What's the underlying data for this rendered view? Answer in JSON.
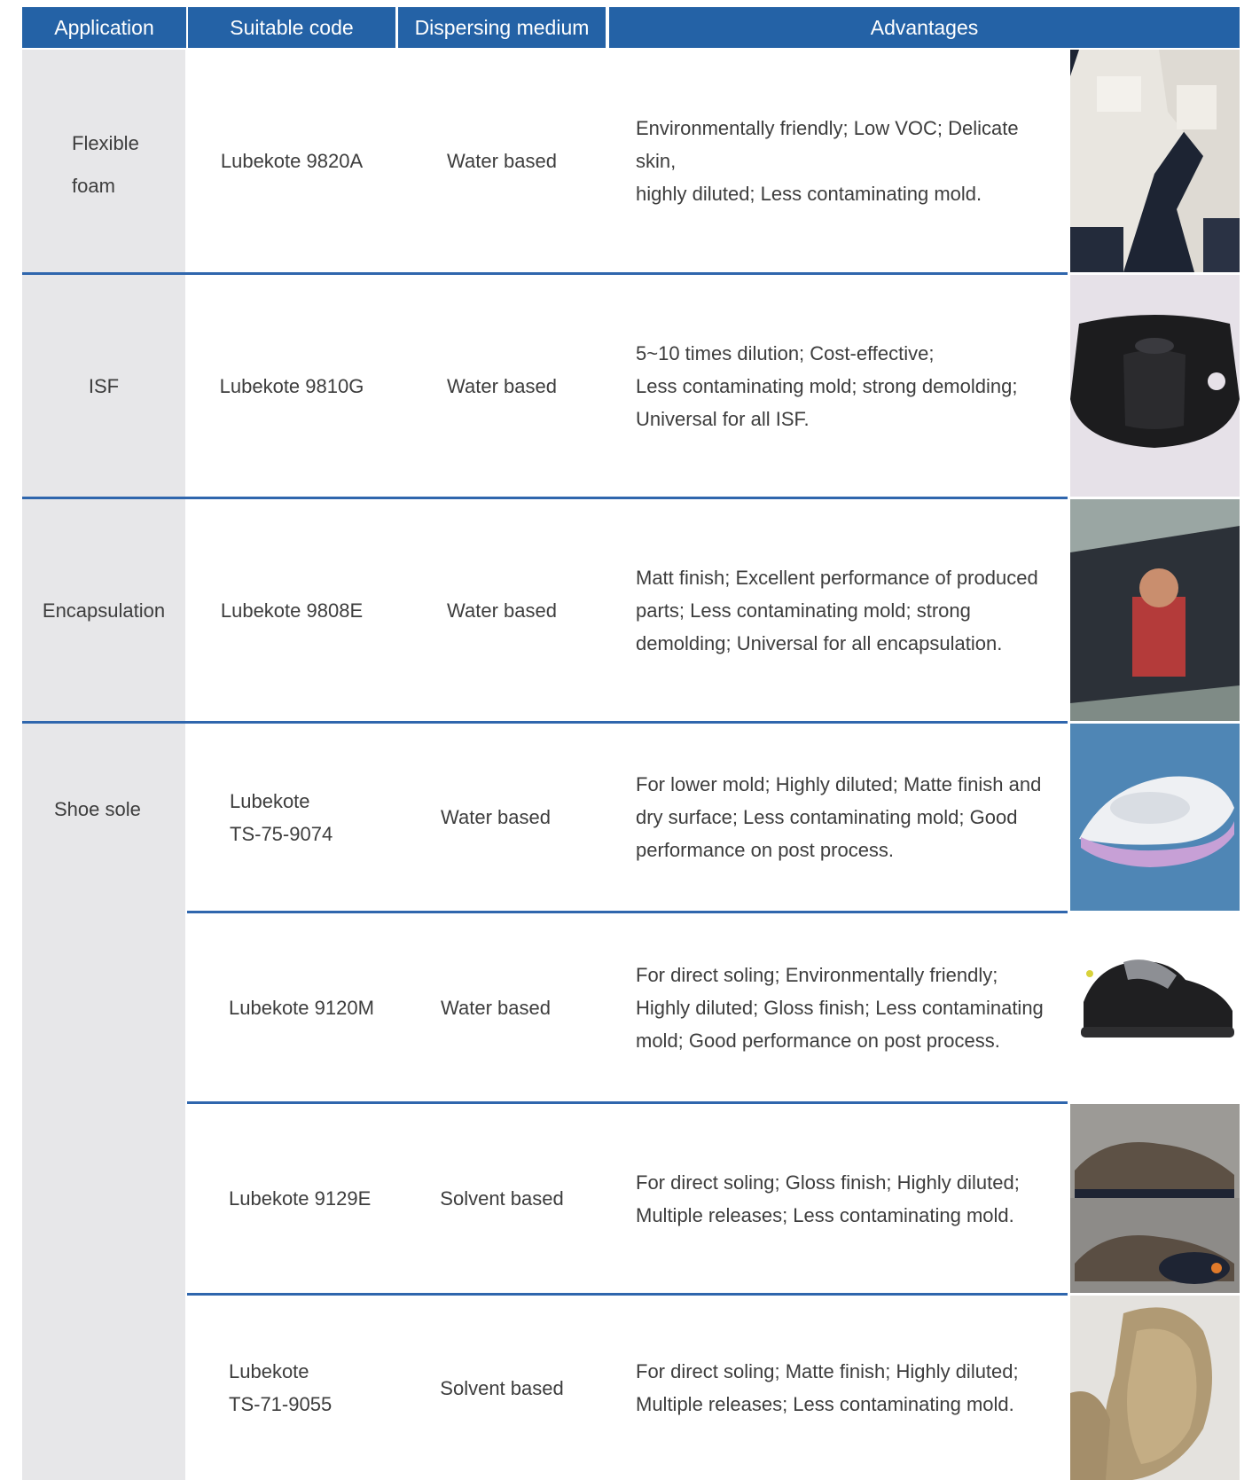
{
  "headers": {
    "application": "Application",
    "code": "Suitable code",
    "medium": "Dispersing medium",
    "advantages": "Advantages"
  },
  "rows": [
    {
      "application": "Flexible\nfoam",
      "code": "Lubekote 9820A",
      "medium": "Water based",
      "advantages": "Environmentally friendly; Low VOC; Delicate skin,\nhighly  diluted; Less contaminating mold."
    },
    {
      "application": "ISF",
      "code": "Lubekote 9810G",
      "medium": "Water based",
      "advantages": "5~10 times dilution; Cost-effective;\n Less contaminating mold; strong demolding;\nUniversal for all ISF."
    },
    {
      "application": "Encapsulation",
      "code": "Lubekote 9808E",
      "medium": "Water based",
      "advantages": "Matt finish; Excellent performance of produced\nparts; Less contaminating mold; strong\ndemolding; Universal for all encapsulation."
    },
    {
      "application": "Shoe sole",
      "code": "Lubekote\nTS-75-9074",
      "medium": "Water based",
      "advantages": "For lower mold; Highly diluted; Matte finish and\ndry surface; Less contaminating mold; Good\nperformance on post process."
    },
    {
      "code": "Lubekote 9120M",
      "medium": "Water based",
      "advantages": "For direct soling; Environmentally friendly;\nHighly diluted; Gloss finish; Less contaminating\nmold; Good performance on post process."
    },
    {
      "code": "Lubekote 9129E",
      "medium": "Solvent based",
      "advantages": "For direct soling; Gloss finish; Highly diluted;\nMultiple releases; Less contaminating mold."
    },
    {
      "code": "Lubekote\nTS-71-9055",
      "medium": "Solvent based",
      "advantages": "For direct soling; Matte finish; Highly diluted;\nMultiple releases; Less contaminating mold."
    }
  ],
  "colors": {
    "header_bg": "#2462a6",
    "divider": "#2f66ad",
    "application_bg": "#e7e7e9"
  }
}
